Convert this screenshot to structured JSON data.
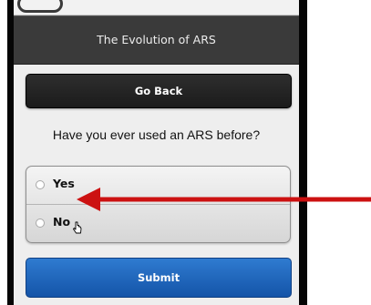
{
  "header": {
    "title": "The Evolution of ARS"
  },
  "back_button": {
    "label": "Go Back"
  },
  "question": {
    "text": "Have you ever used an ARS before?"
  },
  "options": [
    {
      "label": "Yes",
      "selected": false
    },
    {
      "label": "No",
      "selected": false
    }
  ],
  "submit_button": {
    "label": "Submit"
  },
  "colors": {
    "header_bg": "#3a3a3a",
    "back_button_bg": "#1f1f1f",
    "submit_button_bg": "#1d63b8",
    "annotation_arrow": "#cc1111"
  },
  "icons": {
    "cursor": "pointer-hand-icon",
    "arrow": "red-arrow-annotation"
  }
}
